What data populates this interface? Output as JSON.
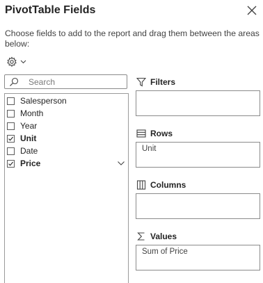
{
  "panel": {
    "title": "PivotTable Fields",
    "description": "Choose fields to add to the report and drag them between the areas below:"
  },
  "search": {
    "placeholder": "Search",
    "value": ""
  },
  "fields": [
    {
      "label": "Salesperson",
      "checked": false
    },
    {
      "label": "Month",
      "checked": false
    },
    {
      "label": "Year",
      "checked": false
    },
    {
      "label": "Unit",
      "checked": true
    },
    {
      "label": "Date",
      "checked": false
    },
    {
      "label": "Price",
      "checked": true
    }
  ],
  "areas": {
    "filters": {
      "title": "Filters",
      "icon": "filter-icon",
      "items": []
    },
    "rows": {
      "title": "Rows",
      "icon": "rows-icon",
      "items": [
        "Unit"
      ]
    },
    "columns": {
      "title": "Columns",
      "icon": "columns-icon",
      "items": []
    },
    "values": {
      "title": "Values",
      "icon": "sigma-icon",
      "items": [
        "Sum of Price"
      ]
    }
  }
}
